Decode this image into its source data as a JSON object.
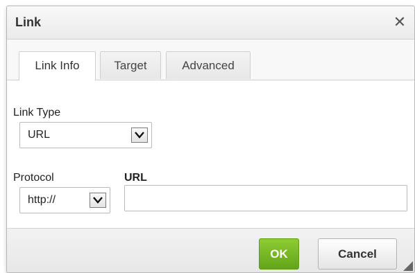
{
  "dialog": {
    "title": "Link",
    "close_glyph": "✕"
  },
  "tabs": [
    {
      "label": "Link Info",
      "active": true
    },
    {
      "label": "Target",
      "active": false
    },
    {
      "label": "Advanced",
      "active": false
    }
  ],
  "form": {
    "link_type": {
      "label": "Link Type",
      "value": "URL"
    },
    "protocol": {
      "label": "Protocol",
      "value": "http://"
    },
    "url": {
      "label": "URL",
      "value": ""
    }
  },
  "footer": {
    "ok_label": "OK",
    "cancel_label": "Cancel"
  },
  "colors": {
    "ok_button": "#6fb126",
    "title_bar": "#f1f1f1"
  },
  "icons": {
    "close": "close-icon",
    "dropdown": "chevron-down-icon",
    "resize": "resize-grip-icon"
  }
}
